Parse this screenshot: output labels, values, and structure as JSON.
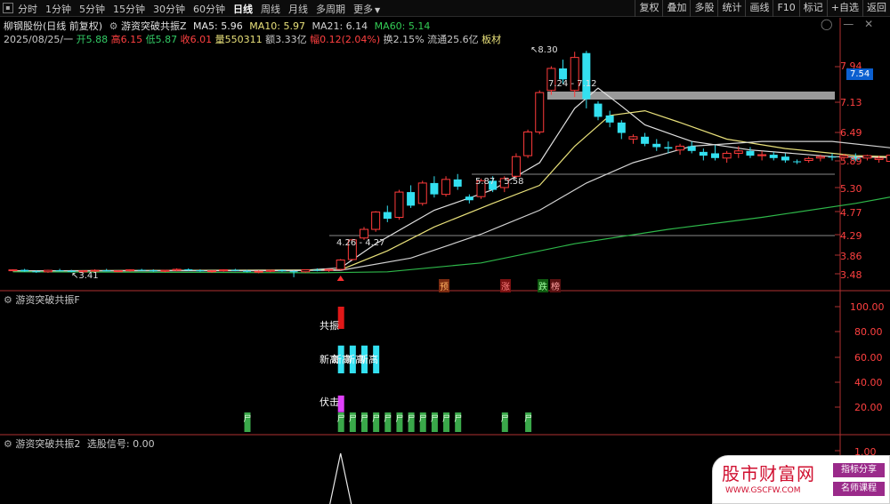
{
  "toolbar": {
    "periods": [
      "分时",
      "1分钟",
      "5分钟",
      "15分钟",
      "30分钟",
      "60分钟",
      "日线",
      "周线",
      "月线",
      "多周期",
      "更多"
    ],
    "active_period": "日线",
    "more_arrow": "▼",
    "tools": [
      "复权",
      "叠加",
      "多股",
      "统计",
      "画线",
      "F10",
      "标记",
      "+自选",
      "返回"
    ]
  },
  "header": {
    "stock": "柳钢股份(日线 前复权)",
    "indicator": "游资突破共振Z",
    "ma5": "MA5: 5.96",
    "ma10": "MA10: 5.97",
    "ma21": "MA21: 6.14",
    "ma60": "MA60: 5.14",
    "date": "2025/08/25/一",
    "open": "开5.88",
    "high": "高6.15",
    "low": "低5.87",
    "close": "收6.01",
    "volume": "量550311",
    "amount": "额3.33亿",
    "change": "幅0.12(2.04%)",
    "turnover": "换2.15%",
    "float": "流通25.6亿",
    "board": "板材"
  },
  "colors": {
    "up": "#ff3b3b",
    "down": "#33e0f0",
    "ma5": "#e0e0e0",
    "ma10": "#e8e07a",
    "ma21": "#d2d2d2",
    "ma60": "#2eb84a",
    "green": "#33cc66",
    "magenta": "#e040fb"
  },
  "main_axis": [
    "7.94",
    "7.54",
    "7.13",
    "6.49",
    "5.89",
    "5.30",
    "4.77",
    "4.29",
    "3.86",
    "3.48"
  ],
  "price_flag": "7.54",
  "annotations": {
    "high": "8.30",
    "low": "3.41",
    "range1": "7.24 - 7.12",
    "range2": "5.87 - 5.58",
    "range3": "4.26 - 4.27"
  },
  "event_labels": [
    "预",
    "涨",
    "跌",
    "榜"
  ],
  "panel2": {
    "title": "游资突破共振F",
    "labels": {
      "resonance": "共振",
      "new_high": "新高",
      "ambush": "伏击"
    },
    "axis": [
      "100.00",
      "80.00",
      "60.00",
      "40.00",
      "20.00"
    ],
    "small_mark": "尸"
  },
  "panel3": {
    "title": "游资突破共振2",
    "signal": "选股信号: 0.00",
    "axis": [
      "1.00"
    ]
  },
  "watermark": {
    "title": "股市财富网",
    "url": "WWW.GSCFW.COM",
    "tag1": "指标分享",
    "tag2": "名师课程"
  },
  "chart_data": {
    "type": "candlestick",
    "candles": [
      [
        3.55,
        3.57,
        3.53,
        3.56
      ],
      [
        3.56,
        3.58,
        3.52,
        3.53
      ],
      [
        3.53,
        3.55,
        3.5,
        3.52
      ],
      [
        3.52,
        3.56,
        3.5,
        3.55
      ],
      [
        3.55,
        3.58,
        3.53,
        3.54
      ],
      [
        3.54,
        3.56,
        3.51,
        3.52
      ],
      [
        3.52,
        3.55,
        3.5,
        3.54
      ],
      [
        3.54,
        3.57,
        3.52,
        3.55
      ],
      [
        3.55,
        3.58,
        3.53,
        3.53
      ],
      [
        3.53,
        3.55,
        3.51,
        3.54
      ],
      [
        3.54,
        3.57,
        3.52,
        3.56
      ],
      [
        3.56,
        3.58,
        3.54,
        3.55
      ],
      [
        3.55,
        3.57,
        3.52,
        3.53
      ],
      [
        3.53,
        3.56,
        3.51,
        3.55
      ],
      [
        3.55,
        3.59,
        3.53,
        3.57
      ],
      [
        3.57,
        3.59,
        3.54,
        3.55
      ],
      [
        3.55,
        3.57,
        3.52,
        3.53
      ],
      [
        3.53,
        3.55,
        3.5,
        3.54
      ],
      [
        3.54,
        3.57,
        3.52,
        3.56
      ],
      [
        3.56,
        3.58,
        3.53,
        3.54
      ],
      [
        3.54,
        3.56,
        3.51,
        3.52
      ],
      [
        3.52,
        3.55,
        3.49,
        3.53
      ],
      [
        3.53,
        3.56,
        3.51,
        3.55
      ],
      [
        3.55,
        3.57,
        3.52,
        3.53
      ],
      [
        3.53,
        3.55,
        3.41,
        3.52
      ],
      [
        3.52,
        3.57,
        3.5,
        3.56
      ],
      [
        3.56,
        3.59,
        3.53,
        3.55
      ],
      [
        3.55,
        3.58,
        3.52,
        3.57
      ],
      [
        3.57,
        3.78,
        3.55,
        3.76
      ],
      [
        3.77,
        4.2,
        3.75,
        4.18
      ],
      [
        4.22,
        4.45,
        4.18,
        4.4
      ],
      [
        4.4,
        4.78,
        4.35,
        4.76
      ],
      [
        4.76,
        4.9,
        4.55,
        4.62
      ],
      [
        4.65,
        5.25,
        4.6,
        5.2
      ],
      [
        5.2,
        5.35,
        4.85,
        4.9
      ],
      [
        4.95,
        5.45,
        4.9,
        5.4
      ],
      [
        5.4,
        5.55,
        5.08,
        5.15
      ],
      [
        5.15,
        5.55,
        5.1,
        5.48
      ],
      [
        5.48,
        5.6,
        5.25,
        5.32
      ],
      [
        5.1,
        5.15,
        4.95,
        5.02
      ],
      [
        5.1,
        5.5,
        5.05,
        5.45
      ],
      [
        5.45,
        5.55,
        5.2,
        5.25
      ],
      [
        5.3,
        5.55,
        5.2,
        5.5
      ],
      [
        5.55,
        6.05,
        5.5,
        5.98
      ],
      [
        6.0,
        6.55,
        5.95,
        6.5
      ],
      [
        6.5,
        7.4,
        6.45,
        7.35
      ],
      [
        7.4,
        7.95,
        7.3,
        7.9
      ],
      [
        7.9,
        8.1,
        7.55,
        7.65
      ],
      [
        7.4,
        8.28,
        7.25,
        8.15
      ],
      [
        8.25,
        8.3,
        7.0,
        7.2
      ],
      [
        7.1,
        7.15,
        6.75,
        6.82
      ],
      [
        6.85,
        6.95,
        6.6,
        6.7
      ],
      [
        6.7,
        6.75,
        6.35,
        6.48
      ],
      [
        6.35,
        6.45,
        6.25,
        6.4
      ],
      [
        6.4,
        6.48,
        6.2,
        6.25
      ],
      [
        6.25,
        6.35,
        6.1,
        6.18
      ],
      [
        6.18,
        6.3,
        6.05,
        6.15
      ],
      [
        6.12,
        6.25,
        6.02,
        6.2
      ],
      [
        6.2,
        6.3,
        6.05,
        6.1
      ],
      [
        6.08,
        6.15,
        5.9,
        6.0
      ],
      [
        6.05,
        6.22,
        5.9,
        5.95
      ],
      [
        5.95,
        6.1,
        5.85,
        6.05
      ],
      [
        6.05,
        6.2,
        5.95,
        6.1
      ],
      [
        6.1,
        6.18,
        5.95,
        6.0
      ],
      [
        6.0,
        6.1,
        5.9,
        6.02
      ],
      [
        6.02,
        6.08,
        5.9,
        5.95
      ],
      [
        5.98,
        6.05,
        5.85,
        5.9
      ],
      [
        5.88,
        5.92,
        5.82,
        5.86
      ],
      [
        5.9,
        5.98,
        5.85,
        5.94
      ],
      [
        5.95,
        6.02,
        5.88,
        5.98
      ],
      [
        5.98,
        6.05,
        5.9,
        5.96
      ],
      [
        5.96,
        6.04,
        5.9,
        6.0
      ],
      [
        5.97,
        6.05,
        5.88,
        5.92
      ],
      [
        5.95,
        6.02,
        5.9,
        6.0
      ],
      [
        5.92,
        6.0,
        5.85,
        5.95
      ],
      [
        5.88,
        6.15,
        5.87,
        6.01
      ]
    ],
    "mavg": {
      "ma5": [
        [
          0,
          3.54
        ],
        [
          24,
          3.54
        ],
        [
          28,
          3.6
        ],
        [
          31,
          4.1
        ],
        [
          36,
          4.8
        ],
        [
          41,
          5.25
        ],
        [
          45,
          5.85
        ],
        [
          48,
          7.0
        ],
        [
          50,
          7.45
        ],
        [
          52,
          7.05
        ],
        [
          54,
          6.65
        ],
        [
          58,
          6.3
        ],
        [
          63,
          6.12
        ],
        [
          70,
          5.98
        ],
        [
          76,
          5.96
        ]
      ],
      "ma10": [
        [
          0,
          3.54
        ],
        [
          28,
          3.56
        ],
        [
          32,
          3.95
        ],
        [
          36,
          4.45
        ],
        [
          41,
          4.95
        ],
        [
          45,
          5.35
        ],
        [
          48,
          6.2
        ],
        [
          51,
          6.85
        ],
        [
          54,
          6.95
        ],
        [
          57,
          6.7
        ],
        [
          61,
          6.35
        ],
        [
          66,
          6.15
        ],
        [
          72,
          6.0
        ],
        [
          76,
          5.97
        ]
      ],
      "ma21": [
        [
          0,
          3.54
        ],
        [
          28,
          3.55
        ],
        [
          34,
          3.8
        ],
        [
          40,
          4.3
        ],
        [
          45,
          4.8
        ],
        [
          49,
          5.4
        ],
        [
          53,
          5.85
        ],
        [
          58,
          6.2
        ],
        [
          64,
          6.3
        ],
        [
          70,
          6.3
        ],
        [
          76,
          6.14
        ]
      ],
      "ma60": [
        [
          0,
          3.52
        ],
        [
          26,
          3.5
        ],
        [
          32,
          3.52
        ],
        [
          40,
          3.7
        ],
        [
          48,
          4.1
        ],
        [
          56,
          4.4
        ],
        [
          64,
          4.65
        ],
        [
          72,
          4.95
        ],
        [
          76,
          5.14
        ]
      ]
    },
    "panel2_bars": {
      "resonance": [
        [
          28,
          80,
          100
        ]
      ],
      "new_high": [
        [
          28,
          40,
          65
        ],
        [
          29,
          40,
          65
        ],
        [
          30,
          40,
          65
        ],
        [
          31,
          40,
          65
        ]
      ],
      "ambush": [
        [
          28,
          5,
          20
        ]
      ],
      "small_marks": [
        20,
        28,
        29,
        30,
        31,
        32,
        33,
        34,
        35,
        36,
        37,
        38,
        42,
        44
      ]
    },
    "panel3_signal": {
      "peak_index": 28,
      "value": 1.0
    }
  }
}
